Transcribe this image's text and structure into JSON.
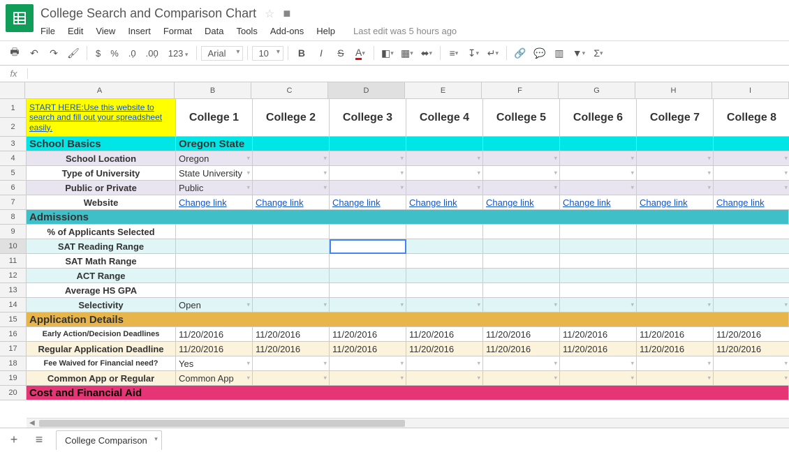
{
  "doc": {
    "title": "College Search and Comparison Chart",
    "last_edit": "Last edit was 5 hours ago"
  },
  "menu": {
    "file": "File",
    "edit": "Edit",
    "view": "View",
    "insert": "Insert",
    "format": "Format",
    "data": "Data",
    "tools": "Tools",
    "addons": "Add-ons",
    "help": "Help"
  },
  "toolbar": {
    "font": "Arial",
    "size": "10",
    "fmt123": "123"
  },
  "cols": [
    "A",
    "B",
    "C",
    "D",
    "E",
    "F",
    "G",
    "H",
    "I"
  ],
  "headers": {
    "c1": "College 1",
    "c2": "College 2",
    "c3": "College 3",
    "c4": "College 4",
    "c5": "College 5",
    "c6": "College 6",
    "c7": "College 7",
    "c8": "College 8"
  },
  "a1": "START HERE:Use this website to search and fill out your spreadsheet easily.",
  "sections": {
    "basics": "School Basics",
    "admissions": "Admissions",
    "appdetails": "Application Details",
    "cost": "Cost and Financial Aid"
  },
  "labels": {
    "location": "School Location",
    "type": "Type of University",
    "pubpriv": "Public or Private",
    "website": "Website",
    "pctsel": "% of Applicants Selected",
    "satr": "SAT Reading Range",
    "satm": "SAT Math Range",
    "act": "ACT Range",
    "gpa": "Average HS GPA",
    "selectivity": "Selectivity",
    "eadl": "Early Action/Decision Deadlines",
    "radl": "Regular Application Deadline",
    "feewaived": "Fee Waived for Financial need?",
    "commonapp": "Common App or Regular"
  },
  "vals": {
    "b3": "Oregon State",
    "b4": "Oregon",
    "b5": "State University",
    "b6": "Public",
    "changelink": "Change link",
    "b14": "Open",
    "date": "11/20/2016",
    "b18": "Yes",
    "b19": "Common App"
  },
  "tab": "College Comparison",
  "fx": "fx"
}
